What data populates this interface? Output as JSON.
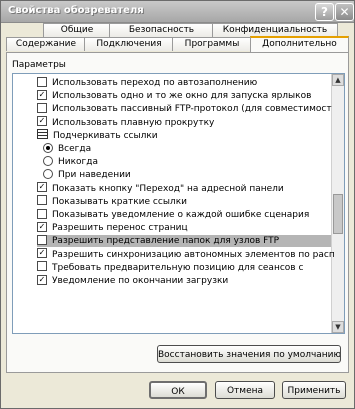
{
  "window": {
    "title": "Свойства обозревателя",
    "help_glyph": "?",
    "close_glyph": "✕"
  },
  "tabs_row1": [
    {
      "label": "Общие"
    },
    {
      "label": "Безопасность"
    },
    {
      "label": "Конфиденциальность"
    }
  ],
  "tabs_row2": [
    {
      "label": "Содержание"
    },
    {
      "label": "Подключения"
    },
    {
      "label": "Программы"
    },
    {
      "label": "Дополнительно"
    }
  ],
  "panel": {
    "group_label": "Параметры"
  },
  "settings": [
    {
      "kind": "checkbox",
      "checked": false,
      "label": "Использовать переход по автозаполнению"
    },
    {
      "kind": "checkbox",
      "checked": true,
      "label": "Использовать одно и то же окно для запуска ярлыков"
    },
    {
      "kind": "checkbox",
      "checked": false,
      "label": "Использовать пассивный FTP-протокол (для совместимост"
    },
    {
      "kind": "checkbox",
      "checked": true,
      "label": "Использовать плавную прокрутку"
    },
    {
      "kind": "group",
      "label": "Подчеркивать ссылки"
    },
    {
      "kind": "radio",
      "checked": true,
      "label": "Всегда"
    },
    {
      "kind": "radio",
      "checked": false,
      "label": "Никогда"
    },
    {
      "kind": "radio",
      "checked": false,
      "label": "При наведении"
    },
    {
      "kind": "checkbox",
      "checked": true,
      "label": "Показать кнопку \"Переход\" на адресной панели"
    },
    {
      "kind": "checkbox",
      "checked": false,
      "label": "Показывать краткие ссылки"
    },
    {
      "kind": "checkbox",
      "checked": false,
      "label": "Показывать уведомление о каждой ошибке сценария"
    },
    {
      "kind": "checkbox",
      "checked": true,
      "label": "Разрешить перенос страниц"
    },
    {
      "kind": "checkbox",
      "checked": false,
      "label": "Разрешить представление папок для узлов FTP",
      "selected": true
    },
    {
      "kind": "checkbox",
      "checked": true,
      "label": "Разрешить синхронизацию автономных элементов по расп"
    },
    {
      "kind": "checkbox",
      "checked": false,
      "label": "Требовать предварительную позицию для сеансов с"
    },
    {
      "kind": "checkbox",
      "checked": true,
      "label": "Уведомление по окончании загрузки"
    }
  ],
  "buttons": {
    "restore": "Восстановить значения по умолчанию",
    "ok": "ОК",
    "cancel": "Отмена",
    "apply": "Применить"
  },
  "scroll": {
    "up_glyph": "▲",
    "down_glyph": "▼"
  }
}
